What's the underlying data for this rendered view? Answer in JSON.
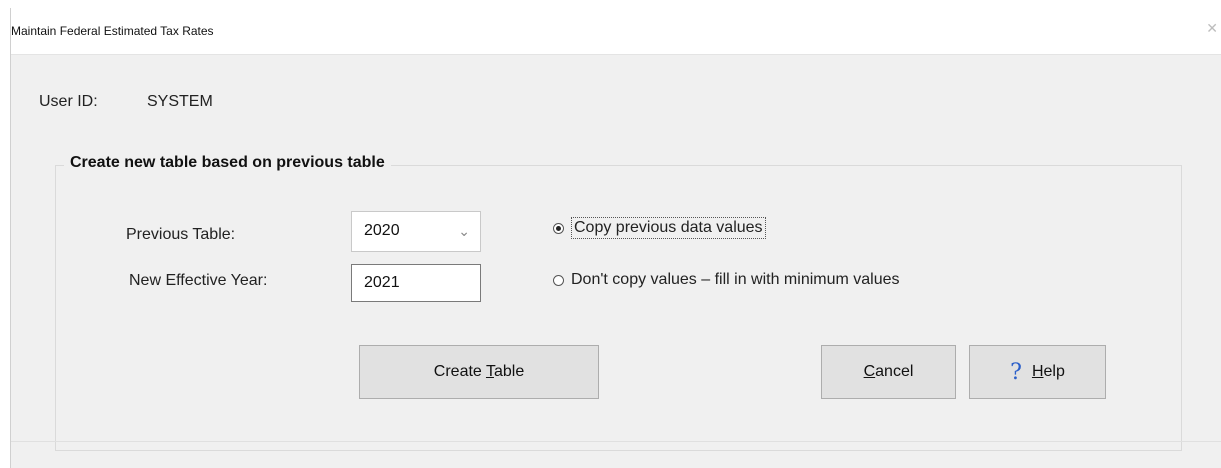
{
  "window": {
    "title": "Maintain Federal Estimated Tax Rates",
    "close_glyph": "✕"
  },
  "user": {
    "label": "User ID:",
    "value": "SYSTEM"
  },
  "group": {
    "title": "Create new table based on previous table"
  },
  "previous_table": {
    "label": "Previous Table:",
    "value": "2020",
    "chevron": "⌄"
  },
  "new_year": {
    "label": "New Effective Year:",
    "value": "2021"
  },
  "options": {
    "copy": {
      "label": "Copy previous data values",
      "checked": true
    },
    "no_copy": {
      "label": "Don't copy values – fill in with minimum values",
      "checked": false
    }
  },
  "buttons": {
    "create_prefix": "Create ",
    "create_accel": "T",
    "create_suffix": "able",
    "cancel_accel": "C",
    "cancel_suffix": "ancel",
    "help_glyph": "?",
    "help_accel": "H",
    "help_suffix": "elp"
  },
  "icons": {
    "help": "question-icon",
    "dropdown": "chevron-down-icon",
    "close": "close-icon"
  },
  "colors": {
    "help_icon": "#2b5fc9",
    "dialog_bg": "#f0f0f0",
    "button_bg": "#e1e1e1"
  }
}
